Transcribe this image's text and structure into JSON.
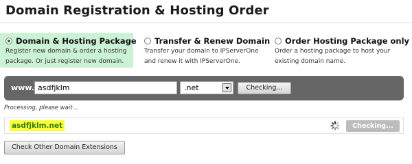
{
  "page": {
    "title": "Domain Registration & Hosting Order"
  },
  "options": [
    {
      "title": "Domain & Hosting Package",
      "desc_line1": "Register new domain & order a hosting",
      "desc_line2": "package. Or just register new domain.",
      "selected": true
    },
    {
      "title": "Transfer & Renew Domain",
      "desc_line1": "Transfer your domain to IPServerOne",
      "desc_line2": "and renew it with IPServerOne.",
      "selected": false
    },
    {
      "title": "Order Hosting Package only",
      "desc_line1": "Order a hosting package to host your",
      "desc_line2": "existing domain name.",
      "selected": false
    }
  ],
  "search": {
    "prefix": "www.",
    "domain_value": "asdfjklm",
    "tld_value": ".net",
    "button_label": "Checking..."
  },
  "status": {
    "processing_text": "Processing, please wait..."
  },
  "result": {
    "domain": "asdfjklm.net",
    "button_label": "Checking..."
  },
  "footer": {
    "other_extensions_label": "Check Other Domain Extensions"
  },
  "colors": {
    "selected_option_bg": "#ccf2d6",
    "search_bar_bg": "#666666",
    "result_highlight": "#ffff33",
    "result_text": "#2a7a1e"
  }
}
